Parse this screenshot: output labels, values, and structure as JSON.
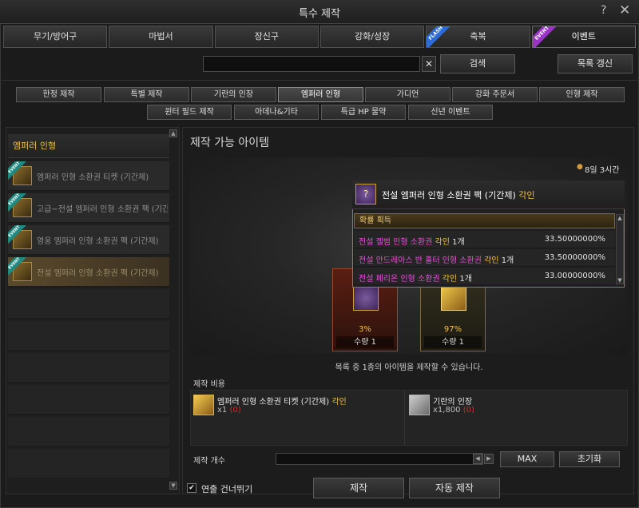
{
  "window": {
    "title": "특수 제작",
    "help": "?",
    "close": "✕"
  },
  "category_tabs": [
    {
      "label": "무기/방어구",
      "badge": ""
    },
    {
      "label": "마법서",
      "badge": ""
    },
    {
      "label": "장신구",
      "badge": ""
    },
    {
      "label": "강화/성장",
      "badge": ""
    },
    {
      "label": "축복",
      "badge": "FLASH"
    },
    {
      "label": "이벤트",
      "badge": "EVENT"
    }
  ],
  "search": {
    "placeholder": "",
    "clear": "✕",
    "button": "검색",
    "refresh": "목록 갱신"
  },
  "sub_tabs_row1": [
    "한정 제작",
    "특별 제작",
    "기란의 인장",
    "엠퍼러 인형",
    "가디언",
    "강화 주문서",
    "인형 제작"
  ],
  "sub_tabs_row2": [
    "윈터 필드 제작",
    "아데나&기타",
    "특급 HP 물약",
    "신년 이벤트"
  ],
  "left_panel": {
    "title": "엠퍼러 인형",
    "items": [
      {
        "label": "엠퍼러 인형 소환권 티켓 (기간제)",
        "badge": "EVENT"
      },
      {
        "label": "고급~전설 엠퍼러 인형 소환권 팩 (기간제)",
        "badge": "EVENT"
      },
      {
        "label": "영웅 엠퍼러 인형 소환권 팩 (기간제)",
        "badge": "EVENT"
      },
      {
        "label": "전설 엠퍼러 인형 소환권 팩 (기간제)",
        "badge": "EVENT"
      }
    ]
  },
  "main": {
    "title": "제작 가능 아이템",
    "timer": "8일 3시간",
    "timer_icon": "●",
    "results": [
      {
        "pct": "3%",
        "qty": "수량 1"
      },
      {
        "pct": "97%",
        "qty": "수량 1"
      }
    ],
    "notice": "목록 중 1종의 아이템을 제작할 수 있습니다.",
    "cost_title": "제작 비용",
    "materials": [
      {
        "name": "엠퍼러 인형 소환권 티켓 (기간제)",
        "tag": "각인",
        "qty": "x1",
        "owned": "(0)"
      },
      {
        "name": "기란의 인장",
        "tag": "",
        "qty": "x1,800",
        "owned": "(0)"
      }
    ],
    "count_label": "제작 개수",
    "max": "MAX",
    "reset": "초기화",
    "skip_label": "연출 건너뛰기",
    "skip_checked": "✔",
    "craft": "제작",
    "auto_craft": "자동 제작"
  },
  "tooltip": {
    "title": "전설 엠퍼러 인형 소환권 팩 (기간제)",
    "title_tag": "각인",
    "icon": "?",
    "section": "확률 획득",
    "rows": [
      {
        "name": "전설 젤범 인형 소환권",
        "tag": "각인",
        "count": "1개",
        "pct": "33.50000000%"
      },
      {
        "name": "전설 안드레아스 반 홀터 인형 소환권",
        "tag": "각인",
        "count": "1개",
        "pct": "33.50000000%"
      },
      {
        "name": "전설 페리온 인형 소환권",
        "tag": "각인",
        "count": "1개",
        "pct": "33.00000000%"
      }
    ]
  },
  "colors": {
    "accent_gold": "#f0c040",
    "legend_pink": "#e64fd6",
    "warning_red": "#d22a2a",
    "event_teal": "#1f8a82"
  }
}
